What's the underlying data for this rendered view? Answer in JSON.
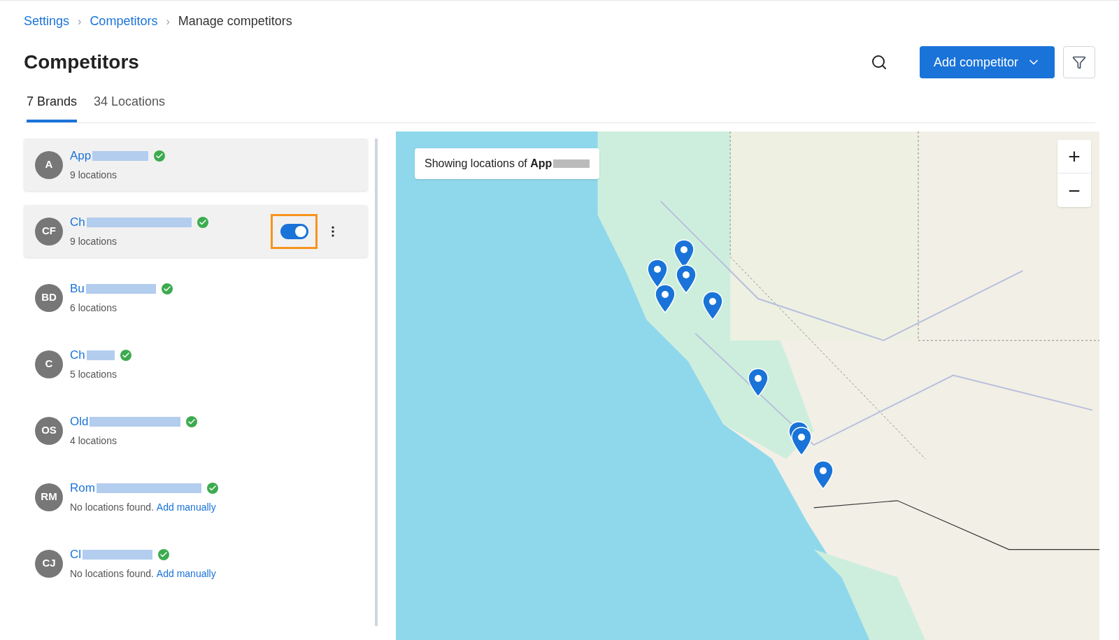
{
  "breadcrumb": [
    {
      "label": "Settings",
      "link": true
    },
    {
      "separator": "›"
    },
    {
      "label": "Competitors",
      "link": true
    },
    {
      "separator": "›"
    },
    {
      "label": "Manage competitors",
      "link": false
    }
  ],
  "title": "Competitors",
  "actions": {
    "add_button": "Add competitor"
  },
  "tabs": [
    {
      "label": "7 Brands",
      "selected": true
    },
    {
      "label": "34 Locations",
      "selected": false
    }
  ],
  "brands": [
    {
      "initials": "A",
      "name": "App",
      "verified": true,
      "locations": "9 locations",
      "selected": true
    },
    {
      "initials": "CF",
      "name": "Ch",
      "verified": true,
      "locations": "9 locations",
      "selected": true,
      "toggle": {
        "on": true
      }
    },
    {
      "initials": "BD",
      "name": "Bu",
      "verified": true,
      "locations": "6 locations",
      "selected": false
    },
    {
      "initials": "C",
      "name": "Ch",
      "verified": true,
      "locations": "5 locations",
      "selected": false
    },
    {
      "initials": "OS",
      "name": "Old",
      "verified": true,
      "locations": "4 locations",
      "selected": false
    },
    {
      "initials": "RM",
      "name": "Rom",
      "verified": true,
      "locations": "No locations found.",
      "link": "Add manually",
      "selected": false
    },
    {
      "initials": "CJ",
      "name": "Cl",
      "verified": true,
      "locations": "No locations found.",
      "link": "Add manually",
      "selected": false
    }
  ],
  "map": {
    "kind": "picture",
    "banner": "Showing locations of **App**",
    "zoom_in": "+",
    "zoom_out": "−"
  }
}
